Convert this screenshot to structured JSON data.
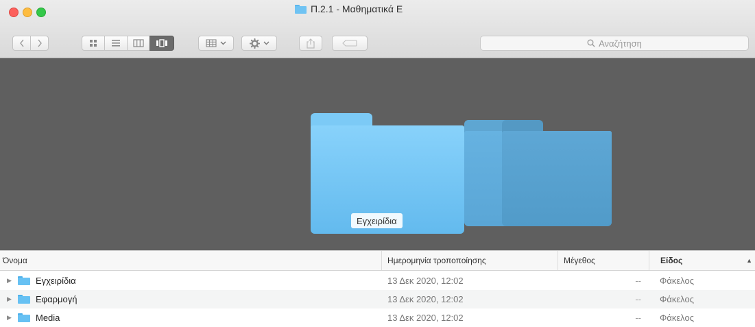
{
  "window": {
    "title": "Π.2.1 - Μαθηματικά Ε"
  },
  "toolbar": {
    "back_icon": "chevron-left-icon",
    "forward_icon": "chevron-right-icon",
    "view_modes": [
      {
        "name": "icon-view",
        "icon": "grid-icon",
        "active": false
      },
      {
        "name": "list-view",
        "icon": "list-icon",
        "active": false
      },
      {
        "name": "column-view",
        "icon": "columns-icon",
        "active": false
      },
      {
        "name": "cover-flow-view",
        "icon": "coverflow-icon",
        "active": true
      }
    ],
    "group_icon": "group-grid-icon",
    "action_icon": "gear-icon",
    "share_icon": "share-icon",
    "tags_icon": "tag-icon",
    "search": {
      "placeholder": "Αναζήτηση",
      "icon": "search-icon"
    }
  },
  "coverflow": {
    "selected_label": "Εγχειρίδια"
  },
  "list": {
    "columns": {
      "name": "Όνομα",
      "date": "Ημερομηνία τροποποίησης",
      "size": "Μέγεθος",
      "kind": "Είδος"
    },
    "sort_column": "kind",
    "rows": [
      {
        "name": "Εγχειρίδια",
        "date": "13 Δεκ 2020, 12:02",
        "size": "--",
        "kind": "Φάκελος"
      },
      {
        "name": "Εφαρμογή",
        "date": "13 Δεκ 2020, 12:02",
        "size": "--",
        "kind": "Φάκελος"
      },
      {
        "name": "Media",
        "date": "13 Δεκ 2020, 12:02",
        "size": "--",
        "kind": "Φάκελος"
      }
    ]
  },
  "colors": {
    "folder_blue": "#67c1f3",
    "coverflow_bg": "#5f5f5f",
    "active_view_button": "#6b6b6b"
  }
}
